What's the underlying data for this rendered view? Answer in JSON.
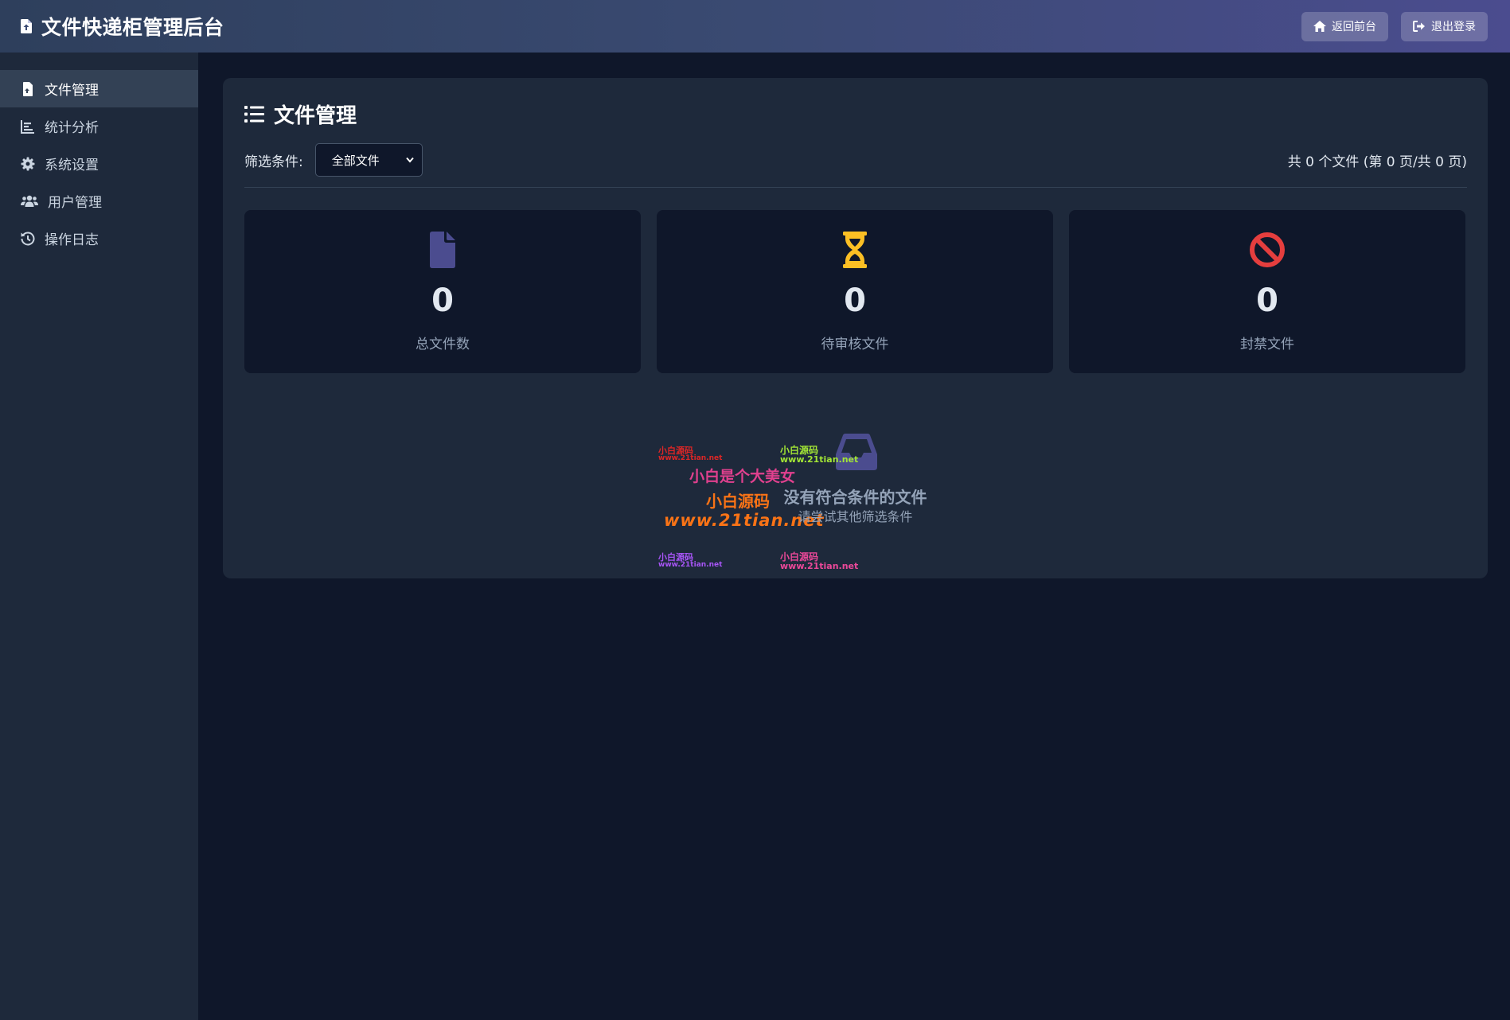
{
  "header": {
    "title": "文件快递柜管理后台",
    "back_button": "返回前台",
    "logout_button": "退出登录"
  },
  "sidebar": {
    "items": [
      {
        "label": "文件管理",
        "icon": "file-icon",
        "active": true
      },
      {
        "label": "统计分析",
        "icon": "chart-icon",
        "active": false
      },
      {
        "label": "系统设置",
        "icon": "gear-icon",
        "active": false
      },
      {
        "label": "用户管理",
        "icon": "users-icon",
        "active": false
      },
      {
        "label": "操作日志",
        "icon": "history-icon",
        "active": false
      }
    ]
  },
  "main": {
    "title": "文件管理",
    "filter_label": "筛选条件:",
    "filter_selected": "全部文件",
    "count_text": "共 0 个文件 (第 0 页/共 0 页)",
    "stats": [
      {
        "value": "0",
        "label": "总文件数",
        "icon": "file-icon",
        "color": "#4b4c8f"
      },
      {
        "value": "0",
        "label": "待审核文件",
        "icon": "hourglass-icon",
        "color": "#fbbf24"
      },
      {
        "value": "0",
        "label": "封禁文件",
        "icon": "ban-icon",
        "color": "#e53e3e"
      }
    ],
    "empty": {
      "title": "没有符合条件的文件",
      "subtitle": "请尝试其他筛选条件"
    }
  },
  "watermarks": [
    {
      "line1": "小白源码",
      "line2": "www.21tian.net",
      "color": "#dc2626"
    },
    {
      "line1": "小白源码",
      "line2": "www.21tian.net",
      "color": "#a3e635"
    },
    {
      "line1": "小白是个大美女",
      "color": "#e0408e"
    },
    {
      "line1": "小白源码",
      "color": "#f97316"
    },
    {
      "line1": "www.21tian.net",
      "color": "#f97316"
    },
    {
      "line1": "小白源码",
      "line2": "www.21tian.net",
      "color": "#a855f7"
    },
    {
      "line1": "小白源码",
      "line2": "www.21tian.net",
      "color": "#ec4899"
    }
  ],
  "colors": {
    "accent": "#4b4c8f",
    "background": "#0f172a",
    "panel": "#1e293b"
  }
}
